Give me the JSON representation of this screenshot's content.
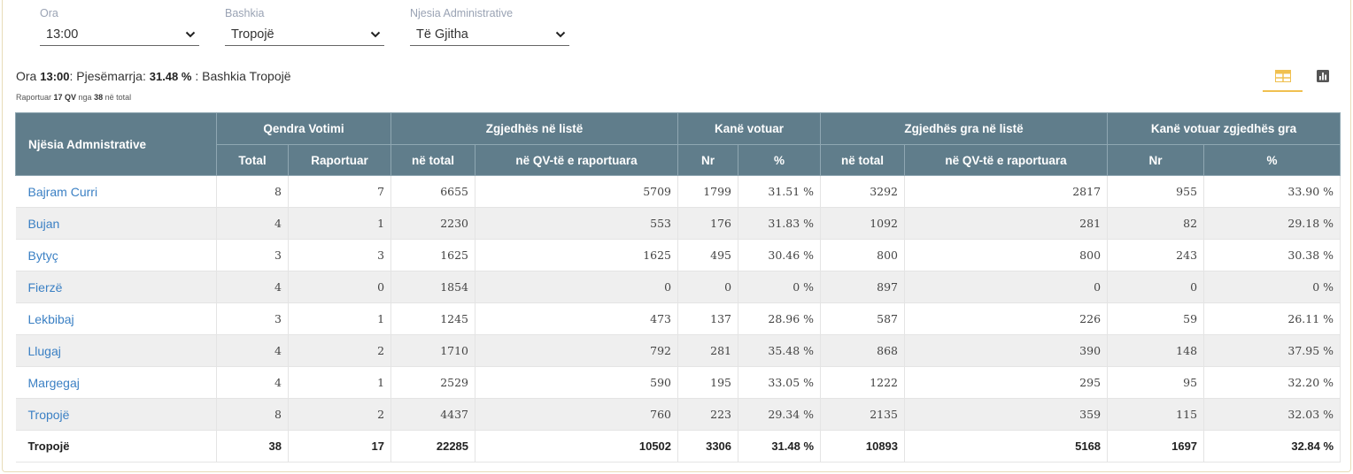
{
  "filters": [
    {
      "label": "Ora",
      "value": "13:00"
    },
    {
      "label": "Bashkia",
      "value": "Tropojë"
    },
    {
      "label": "Njesia Administrative",
      "value": "Të Gjitha"
    }
  ],
  "summary": {
    "prefix": "Ora ",
    "time": "13:00",
    "mid": ": Pjesëmarrja: ",
    "percent": "31.48 %",
    "suffix": " : Bashkia Tropojë",
    "reported_prefix": "Raportuar ",
    "reported_qv": "17 QV",
    "reported_mid": " nga ",
    "reported_total": "38",
    "reported_suffix": " në total"
  },
  "view_toggle": {
    "table_icon": "table-icon",
    "chart_icon": "bar-chart-icon",
    "active": "table"
  },
  "colors": {
    "header_bg": "#607d8b",
    "link": "#3b80c4",
    "accent": "#f0c050"
  },
  "table": {
    "group_headers": {
      "unit": "Njësia Admnistrative",
      "centers": "Qendra Votimi",
      "voters": "Zgjedhës në listë",
      "voted": "Kanë votuar",
      "women": "Zgjedhës gra në listë",
      "women_voted": "Kanë votuar zgjedhës gra"
    },
    "sub_headers": [
      "Total",
      "Raportuar",
      "në total",
      "në QV-të e raportuara",
      "Nr",
      "%",
      "në total",
      "në QV-të e raportuara",
      "Nr",
      "%"
    ],
    "rows": [
      [
        "Bajram Curri",
        "8",
        "7",
        "6655",
        "5709",
        "1799",
        "31.51 %",
        "3292",
        "2817",
        "955",
        "33.90 %"
      ],
      [
        "Bujan",
        "4",
        "1",
        "2230",
        "553",
        "176",
        "31.83 %",
        "1092",
        "281",
        "82",
        "29.18 %"
      ],
      [
        "Bytyç",
        "3",
        "3",
        "1625",
        "1625",
        "495",
        "30.46 %",
        "800",
        "800",
        "243",
        "30.38 %"
      ],
      [
        "Fierzë",
        "4",
        "0",
        "1854",
        "0",
        "0",
        "0 %",
        "897",
        "0",
        "0",
        "0 %"
      ],
      [
        "Lekbibaj",
        "3",
        "1",
        "1245",
        "473",
        "137",
        "28.96 %",
        "587",
        "226",
        "59",
        "26.11 %"
      ],
      [
        "Llugaj",
        "4",
        "2",
        "1710",
        "792",
        "281",
        "35.48 %",
        "868",
        "390",
        "148",
        "37.95 %"
      ],
      [
        "Margegaj",
        "4",
        "1",
        "2529",
        "590",
        "195",
        "33.05 %",
        "1222",
        "295",
        "95",
        "32.20 %"
      ],
      [
        "Tropojë",
        "8",
        "2",
        "4437",
        "760",
        "223",
        "29.34 %",
        "2135",
        "359",
        "115",
        "32.03 %"
      ]
    ],
    "total": [
      "Tropojë",
      "38",
      "17",
      "22285",
      "10502",
      "3306",
      "31.48 %",
      "10893",
      "5168",
      "1697",
      "32.84 %"
    ]
  }
}
